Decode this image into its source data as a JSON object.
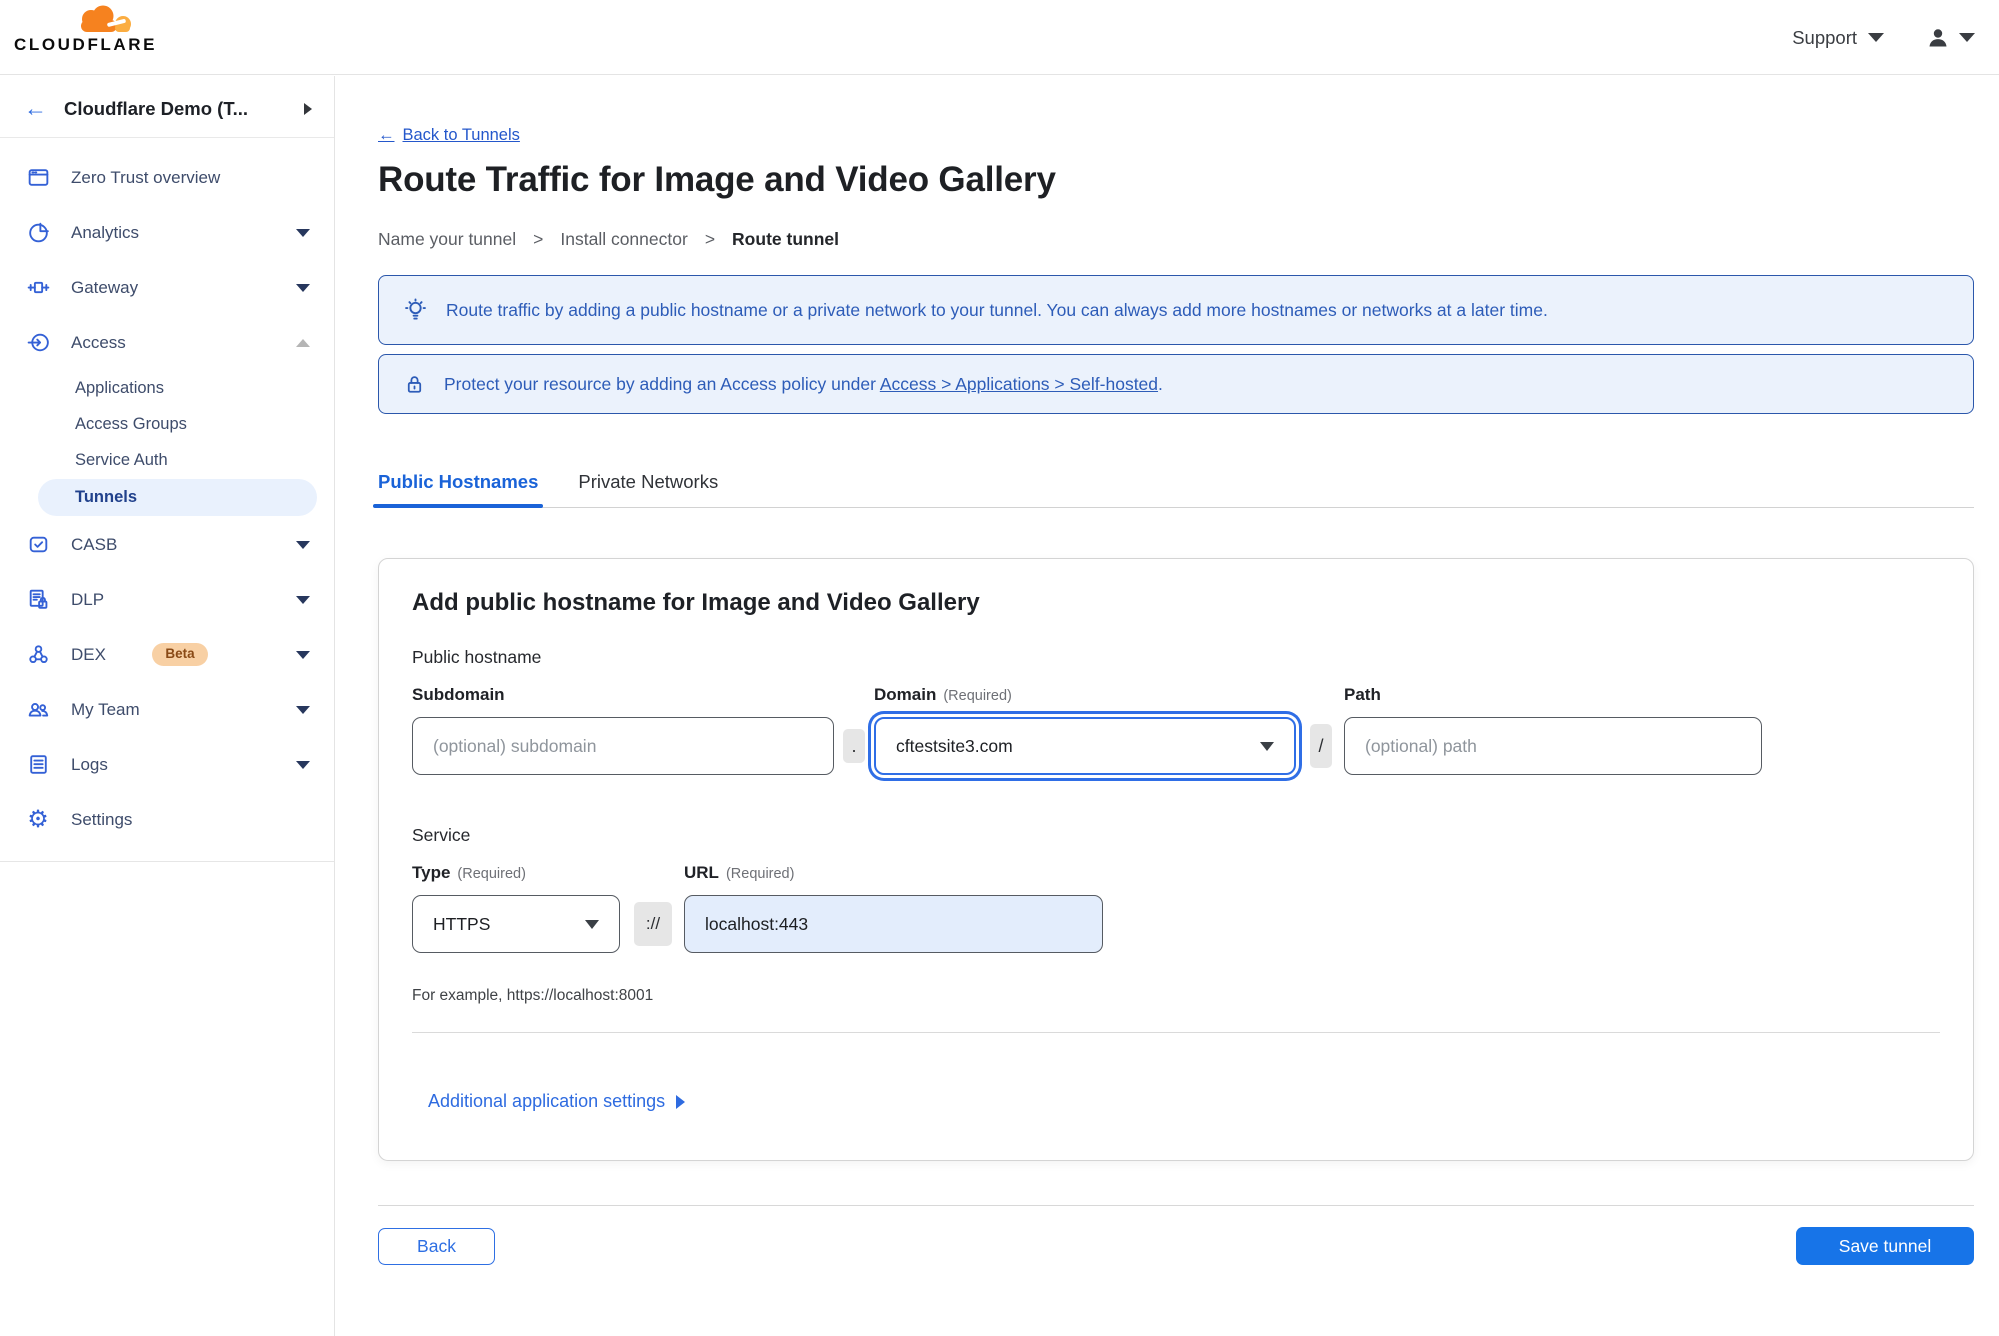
{
  "icons": {
    "gear_glyph": "⚙",
    "back_arrow_glyph": "←"
  },
  "topbar": {
    "brand": "CLOUDFLARE",
    "support_label": "Support"
  },
  "sidebar": {
    "account_label": "Cloudflare Demo (T...",
    "items": [
      {
        "label": "Zero Trust overview"
      },
      {
        "label": "Analytics"
      },
      {
        "label": "Gateway"
      },
      {
        "label": "Access"
      },
      {
        "label": "Applications"
      },
      {
        "label": "Access Groups"
      },
      {
        "label": "Service Auth"
      },
      {
        "label": "Tunnels"
      },
      {
        "label": "CASB"
      },
      {
        "label": "DLP"
      },
      {
        "label": "DEX",
        "badge": "Beta"
      },
      {
        "label": "My Team"
      },
      {
        "label": "Logs"
      },
      {
        "label": "Settings"
      }
    ]
  },
  "page": {
    "back_link_label": "Back to Tunnels",
    "title": "Route Traffic for Image and Video Gallery",
    "steps": {
      "step1": "Name your tunnel",
      "step2": "Install connector",
      "step3": "Route tunnel",
      "separator": ">"
    },
    "banner_route": "Route traffic by adding a public hostname or a private network to your tunnel. You can always add more hostnames or networks at a later time.",
    "banner_protect_prefix": "Protect your resource by adding an Access policy under",
    "banner_protect_link": "Access > Applications > Self-hosted",
    "banner_protect_suffix": ".",
    "tab_public": "Public Hostnames",
    "tab_private": "Private Networks"
  },
  "form": {
    "heading": "Add public hostname for Image and Video Gallery",
    "public_hostname_label": "Public hostname",
    "subdomain_label": "Subdomain",
    "subdomain_placeholder": "(optional) subdomain",
    "dot_separator": ".",
    "domain_label": "Domain",
    "domain_required": "(Required)",
    "domain_value": "cftestsite3.com",
    "slash_separator": "/",
    "path_label": "Path",
    "path_placeholder": "(optional) path",
    "service_label": "Service",
    "type_label": "Type",
    "type_required": "(Required)",
    "type_value": "HTTPS",
    "scheme_separator": "://",
    "url_label": "URL",
    "url_required": "(Required)",
    "url_value": "localhost:443",
    "example_text": "For example, https://localhost:8001",
    "additional_settings_label": "Additional application settings"
  },
  "footer": {
    "back_label": "Back",
    "save_label": "Save tunnel"
  },
  "colors": {
    "accent_blue": "#1774e8",
    "link_blue": "#2457cb",
    "banner_border": "#2b57ab",
    "banner_bg": "#ebf2fc",
    "banner_text": "#2d5cb8",
    "active_nav_bg": "#e9f1fd",
    "beta_badge_bg": "#f8d0a4",
    "logo_orange": "#f6821f",
    "logo_orange_light": "#fbad41"
  }
}
